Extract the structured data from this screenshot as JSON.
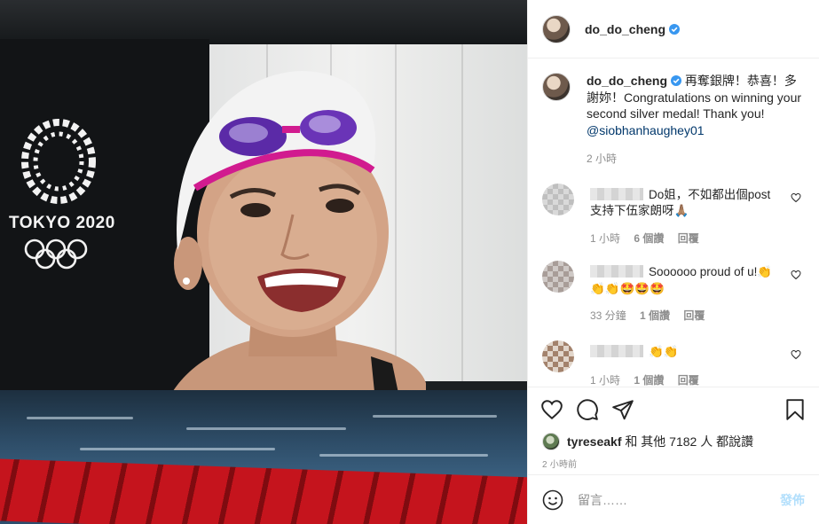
{
  "header": {
    "username": "do_do_cheng",
    "verified": true
  },
  "photo": {
    "event_logo_text": "TOKYO 2020"
  },
  "caption": {
    "username": "do_do_cheng",
    "text": "再奪銀牌！恭喜！多謝妳！Congratulations on winning your second silver medal! Thank you!",
    "mention": "@siobhanhaughey01",
    "time": "2 小時"
  },
  "comments": [
    {
      "text": "Do姐，不如都出個post支持下伍家朗呀🙏🏽",
      "time": "1 小時",
      "likes": "6 個讚",
      "reply": "回覆"
    },
    {
      "text": "Soooooo proud of u!👏👏👏🤩🤩🤩",
      "time": "33 分鐘",
      "likes": "1 個讚",
      "reply": "回覆"
    },
    {
      "text": "👏👏",
      "time": "1 小時",
      "likes": "1 個讚",
      "reply": "回覆"
    }
  ],
  "actions": {
    "like_icon": "heart-icon",
    "comment_icon": "comment-bubble-icon",
    "share_icon": "paper-plane-icon",
    "save_icon": "bookmark-icon"
  },
  "likes": {
    "user": "tyreseakf",
    "rest": "和 其他 7182 人 都說讚"
  },
  "posted_time": "2 小時前",
  "add_comment": {
    "placeholder": "留言……",
    "post_label": "發佈"
  },
  "colors": {
    "verified_blue": "#3897f0",
    "link_navy": "#00376b",
    "muted": "#8e8e8e",
    "post_button_disabled": "#b2dffc"
  }
}
